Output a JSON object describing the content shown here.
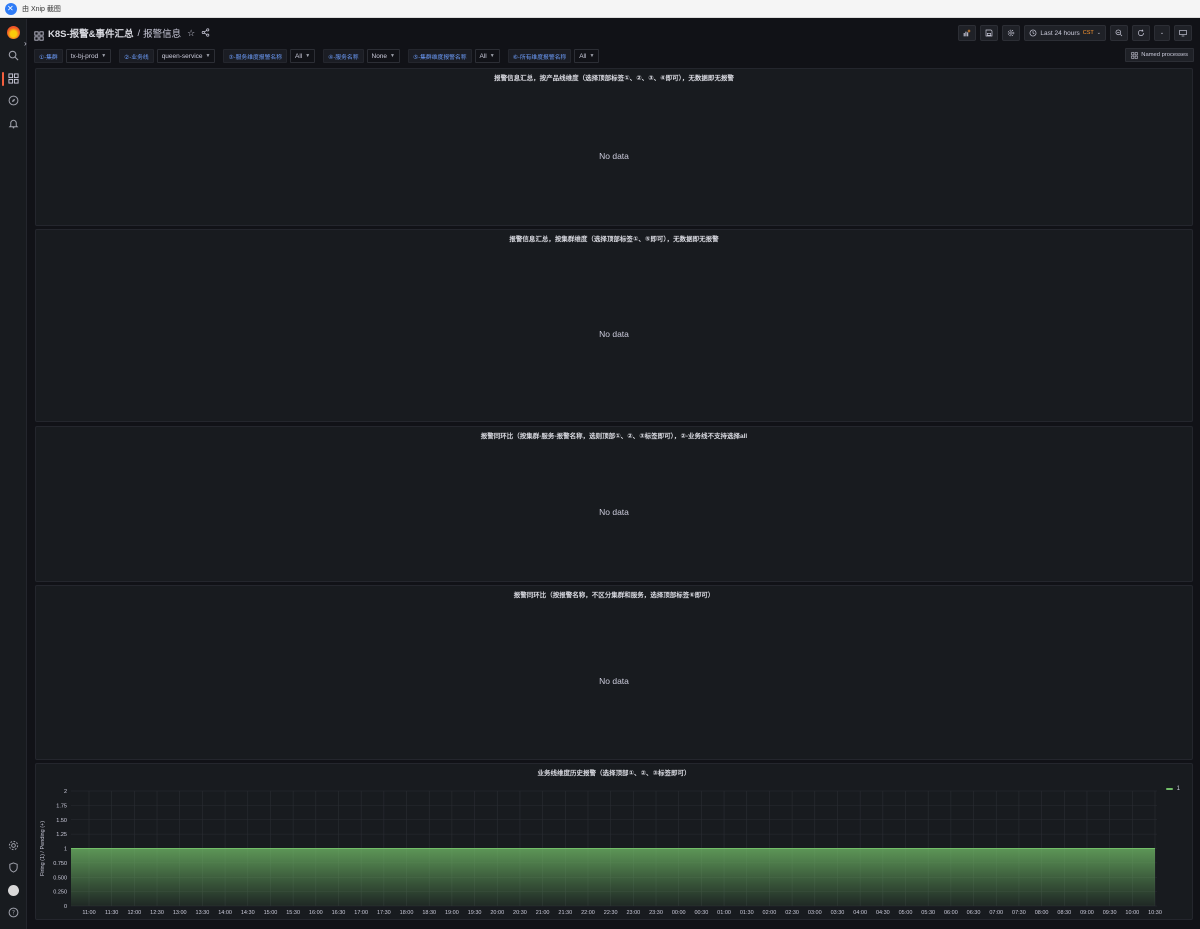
{
  "os": {
    "title": "由 Xnip 截图"
  },
  "nav": {
    "title": "K8S-报警&事件汇总",
    "separator": "/",
    "subtitle": "报警信息",
    "time_range": "Last 24 hours",
    "timezone": "CST"
  },
  "variables": [
    {
      "label": "①-集群",
      "value": "tx-bj-prod"
    },
    {
      "label": "②-业务线",
      "value": "queen-service"
    },
    {
      "label": "③-服务维度报警名称",
      "value": "All"
    },
    {
      "label": "④-服务名称",
      "value": "None"
    },
    {
      "label": "⑤-集群维度报警名称",
      "value": "All"
    },
    {
      "label": "⑥-所有维度报警名称",
      "value": "All"
    }
  ],
  "named_processes": "Named processes",
  "panels": [
    {
      "title": "报警信息汇总，按产品线维度（选择顶部标签①、②、③、④即可），无数据即无报警",
      "nodata": "No data"
    },
    {
      "title": "报警信息汇总，按集群维度（选择顶部标签①、⑤即可），无数据即无报警",
      "nodata": "No data"
    },
    {
      "title": "报警同环比（按集群-服务-报警名称，选则顶部①、②、③标签即可），②-业务线不支持选择all",
      "nodata": "No data"
    },
    {
      "title": "报警同环比（按报警名称，不区分集群和服务，选择顶部标签⑥即可）",
      "nodata": "No data"
    }
  ],
  "chart_panel": {
    "title": "业务线维度历史报警（选择顶部①、②、③标签即可）"
  },
  "chart_data": {
    "type": "area",
    "title": "业务线维度历史报警（选择顶部①、②、③标签即可）",
    "ylabel": "Firing (1) / Pending (+)",
    "xlabel": "",
    "ylim": [
      0,
      2
    ],
    "yticks": [
      "0",
      "0.250",
      "0.500",
      "0.750",
      "1",
      "1.25",
      "1.50",
      "1.75",
      "2"
    ],
    "x": [
      "11:00",
      "11:30",
      "12:00",
      "12:30",
      "13:00",
      "13:30",
      "14:00",
      "14:30",
      "15:00",
      "15:30",
      "16:00",
      "16:30",
      "17:00",
      "17:30",
      "18:00",
      "18:30",
      "19:00",
      "19:30",
      "20:00",
      "20:30",
      "21:00",
      "21:30",
      "22:00",
      "22:30",
      "23:00",
      "23:30",
      "00:00",
      "00:30",
      "01:00",
      "01:30",
      "02:00",
      "02:30",
      "03:00",
      "03:30",
      "04:00",
      "04:30",
      "05:00",
      "05:30",
      "06:00",
      "06:30",
      "07:00",
      "07:30",
      "08:00",
      "08:30",
      "09:00",
      "09:30",
      "10:00",
      "10:30"
    ],
    "series": [
      {
        "name": "1",
        "color": "#73bf69",
        "values": [
          1,
          1,
          1,
          1,
          1,
          1,
          1,
          1,
          1,
          1,
          1,
          1,
          1,
          1,
          1,
          1,
          1,
          1,
          1,
          1,
          1,
          1,
          1,
          1,
          1,
          1,
          1,
          1,
          1,
          1,
          1,
          1,
          1,
          1,
          1,
          1,
          1,
          1,
          1,
          1,
          1,
          1,
          1,
          1,
          1,
          1,
          1,
          1
        ]
      }
    ],
    "grid": true,
    "legend": "top-right"
  }
}
